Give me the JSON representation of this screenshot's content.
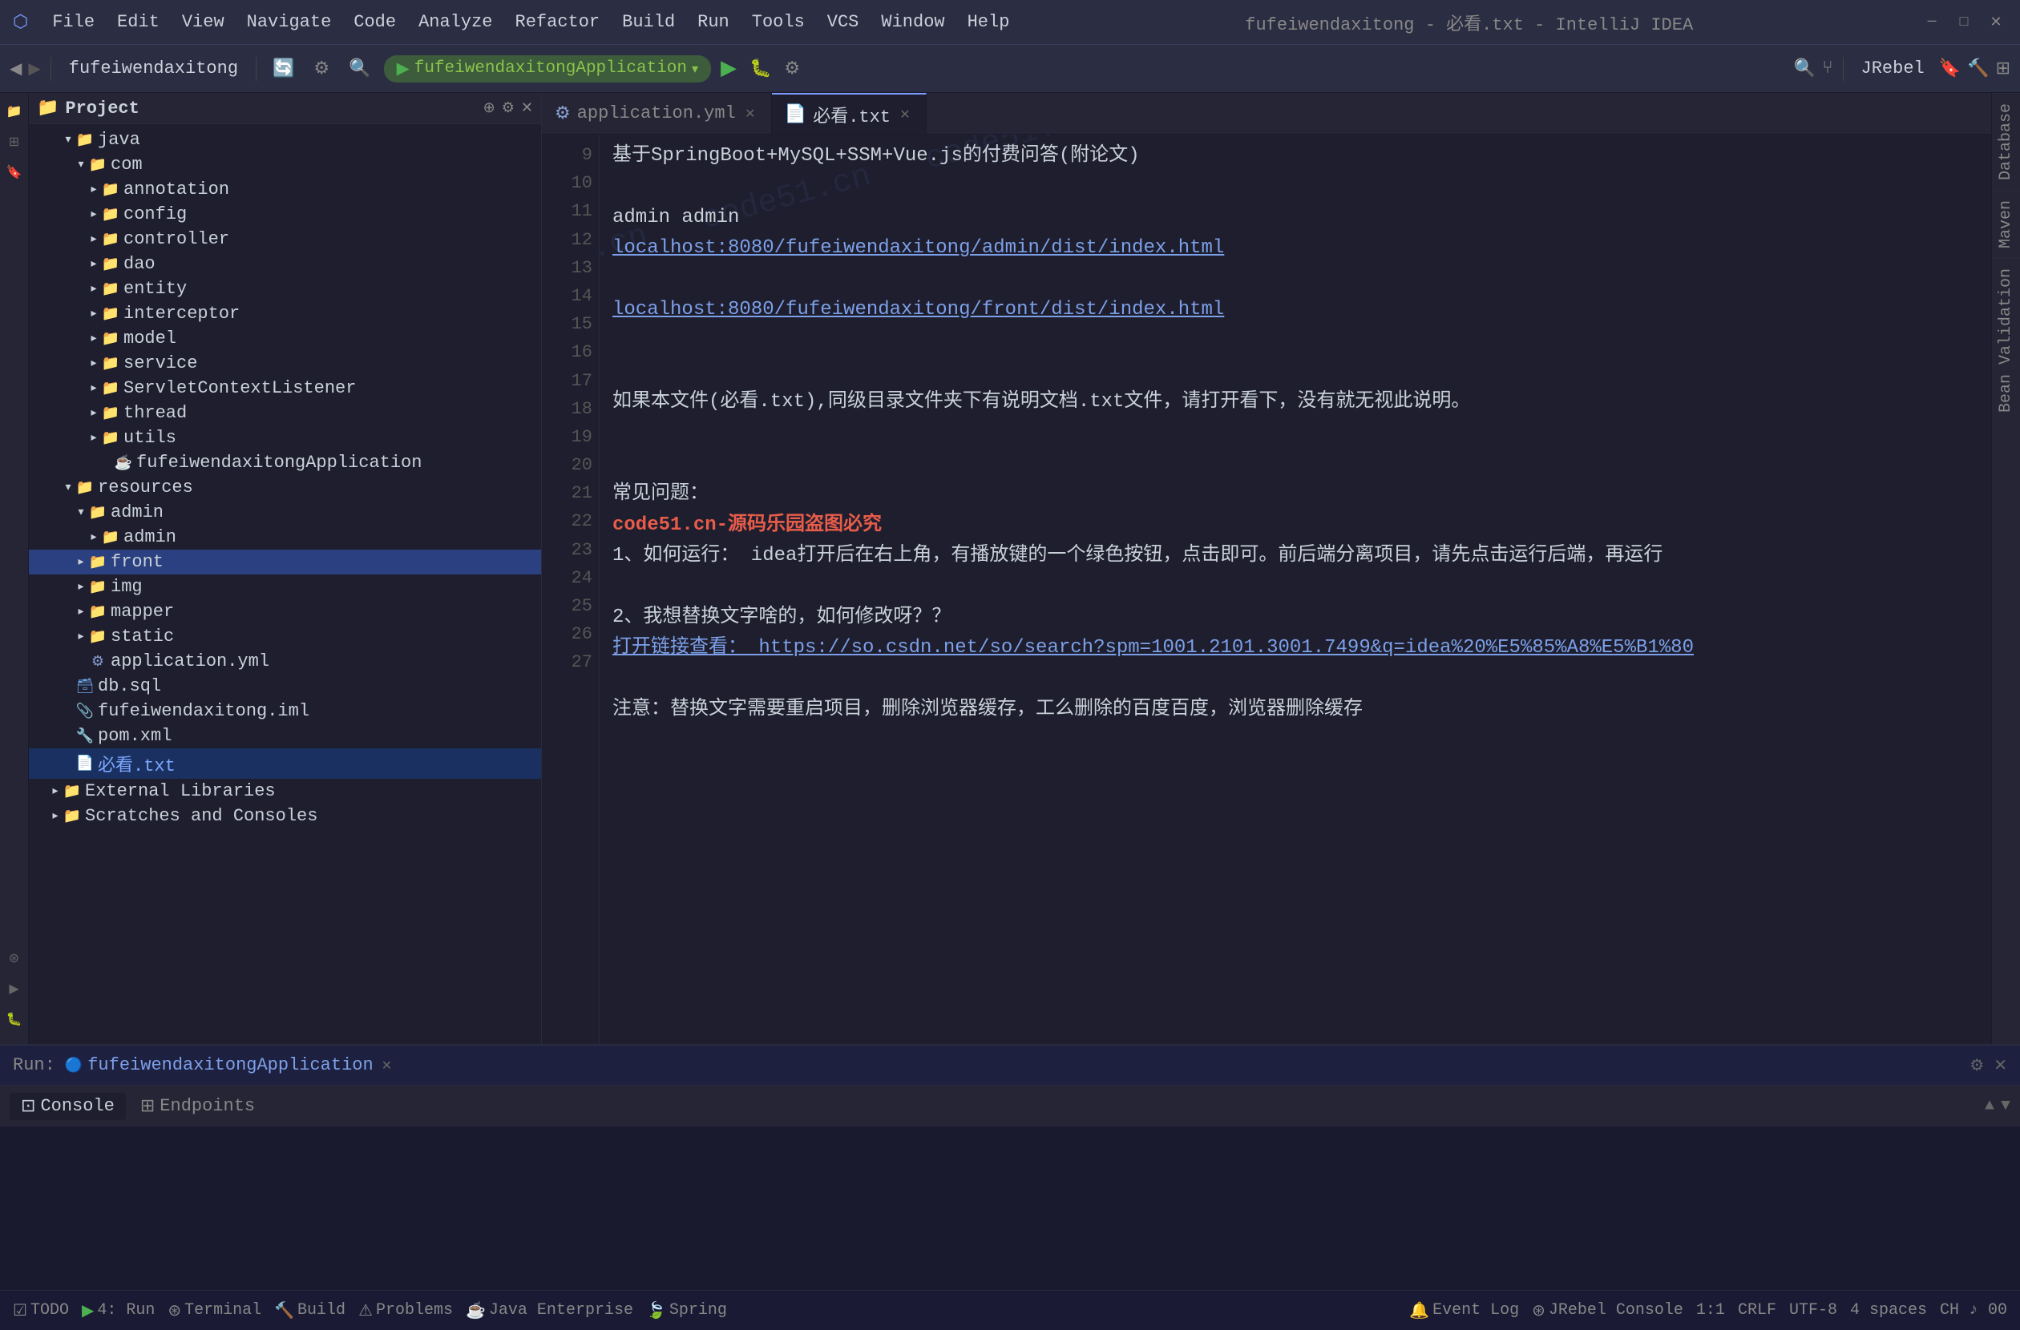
{
  "app": {
    "title": "fufeiwendaxitong - 必看.txt - IntelliJ IDEA"
  },
  "menus": [
    "File",
    "Edit",
    "View",
    "Navigate",
    "Code",
    "Analyze",
    "Refactor",
    "Build",
    "Run",
    "Tools",
    "VCS",
    "Window",
    "Help"
  ],
  "toolbar": {
    "project_name": "fufeiwendaxitong",
    "run_config": "fufeiwendaxitongApplication",
    "jrebel": "JRebel"
  },
  "tabs": {
    "open": [
      {
        "label": "application.yml",
        "icon": "yml",
        "active": false
      },
      {
        "label": "必看.txt",
        "icon": "txt",
        "active": true
      }
    ]
  },
  "project_tree": {
    "header": "Project",
    "items": [
      {
        "indent": 2,
        "type": "folder",
        "label": "java",
        "open": true
      },
      {
        "indent": 3,
        "type": "folder",
        "label": "com",
        "open": true
      },
      {
        "indent": 4,
        "type": "folder",
        "label": "annotation",
        "open": false
      },
      {
        "indent": 4,
        "type": "folder",
        "label": "config",
        "open": false
      },
      {
        "indent": 4,
        "type": "folder",
        "label": "controller",
        "open": false
      },
      {
        "indent": 4,
        "type": "folder",
        "label": "dao",
        "open": false
      },
      {
        "indent": 4,
        "type": "folder",
        "label": "entity",
        "open": false
      },
      {
        "indent": 4,
        "type": "folder",
        "label": "interceptor",
        "open": false
      },
      {
        "indent": 4,
        "type": "folder",
        "label": "model",
        "open": false
      },
      {
        "indent": 4,
        "type": "folder",
        "label": "service",
        "open": false
      },
      {
        "indent": 4,
        "type": "folder",
        "label": "ServletContextListener",
        "open": false
      },
      {
        "indent": 4,
        "type": "folder",
        "label": "thread",
        "open": false
      },
      {
        "indent": 4,
        "type": "folder",
        "label": "utils",
        "open": false
      },
      {
        "indent": 5,
        "type": "java",
        "label": "fufeiwendaxitongApplication",
        "open": false
      },
      {
        "indent": 2,
        "type": "folder",
        "label": "resources",
        "open": true
      },
      {
        "indent": 3,
        "type": "folder",
        "label": "admin",
        "open": true
      },
      {
        "indent": 4,
        "type": "folder",
        "label": "admin",
        "open": false
      },
      {
        "indent": 3,
        "type": "folder",
        "label": "front",
        "open": false,
        "selected": true
      },
      {
        "indent": 3,
        "type": "folder",
        "label": "img",
        "open": false
      },
      {
        "indent": 3,
        "type": "folder",
        "label": "mapper",
        "open": false
      },
      {
        "indent": 3,
        "type": "folder",
        "label": "static",
        "open": false
      },
      {
        "indent": 3,
        "type": "yml",
        "label": "application.yml"
      },
      {
        "indent": 2,
        "type": "sql",
        "label": "db.sql"
      },
      {
        "indent": 2,
        "type": "iml",
        "label": "fufeiwendaxitong.iml"
      },
      {
        "indent": 2,
        "type": "xml",
        "label": "pom.xml"
      },
      {
        "indent": 2,
        "type": "txt",
        "label": "必看.txt",
        "active": true
      },
      {
        "indent": 1,
        "type": "folder",
        "label": "External Libraries",
        "open": false
      },
      {
        "indent": 1,
        "type": "folder",
        "label": "Scratches and Consoles",
        "open": false
      }
    ]
  },
  "editor": {
    "lines": [
      {
        "num": 9,
        "content": "基于SpringBoot+MySQL+SSM+Vue.js的付费问答(附论文)"
      },
      {
        "num": 10,
        "content": ""
      },
      {
        "num": 11,
        "content": "admin admin"
      },
      {
        "num": 12,
        "content": "localhost:8080/fufeiwendaxitong/admin/dist/index.html",
        "type": "url"
      },
      {
        "num": 13,
        "content": ""
      },
      {
        "num": 14,
        "content": "localhost:8080/fufeiwendaxitong/front/dist/index.html",
        "type": "url"
      },
      {
        "num": 15,
        "content": ""
      },
      {
        "num": 16,
        "content": ""
      },
      {
        "num": 17,
        "content": "如果本文件(必看.txt),同级目录文件夹下有说明文档.txt文件，请打开看下，没有就无视此说明。"
      },
      {
        "num": 18,
        "content": ""
      },
      {
        "num": 19,
        "content": ""
      },
      {
        "num": 20,
        "content": "常见问题："
      },
      {
        "num": 21,
        "content": "code51.cn-源码乐园盗图必究",
        "type": "watermark_red"
      },
      {
        "num": 22,
        "content": "1、如何运行：  idea打开后在右上角，有播放键的一个绿色按钮，点击即可。前后端分离项目，请先点击运行后端，再运行"
      },
      {
        "num": 23,
        "content": ""
      },
      {
        "num": 24,
        "content": "2、我想替换文字啥的，如何修改呀？？"
      },
      {
        "num": 25,
        "content": "    打开链接查看：  https://so.csdn.net/so/search?spm=1001.2101.3001.7499&q=idea%20%E5%85%A8%E5%B1%80",
        "type": "url"
      },
      {
        "num": 26,
        "content": ""
      },
      {
        "num": 27,
        "content": "注意：替换文字需要重启项目，删除浏览器缓存，工么删除的百度百度，浏览器删除缓存"
      }
    ],
    "watermark_text": "code51.cn"
  },
  "right_sidebar": {
    "tabs": [
      "Database",
      "Maven",
      "Bean Validation"
    ]
  },
  "bottom": {
    "run_label": "Run:",
    "run_app": "fufeiwendaxitongApplication",
    "tabs": [
      "Console",
      "Endpoints"
    ]
  },
  "status_bar": {
    "todo": "TODO",
    "run": "4: Run",
    "terminal": "Terminal",
    "build": "Build",
    "problems": "Problems",
    "java_enterprise": "Java Enterprise",
    "spring": "Spring",
    "event_log": "Event Log",
    "jrebel_console": "JRebel Console",
    "position": "1:1",
    "encoding": "UTF-8",
    "line_sep": "CRLF",
    "indent": "4 spaces",
    "language": "CH ♪ 00"
  }
}
